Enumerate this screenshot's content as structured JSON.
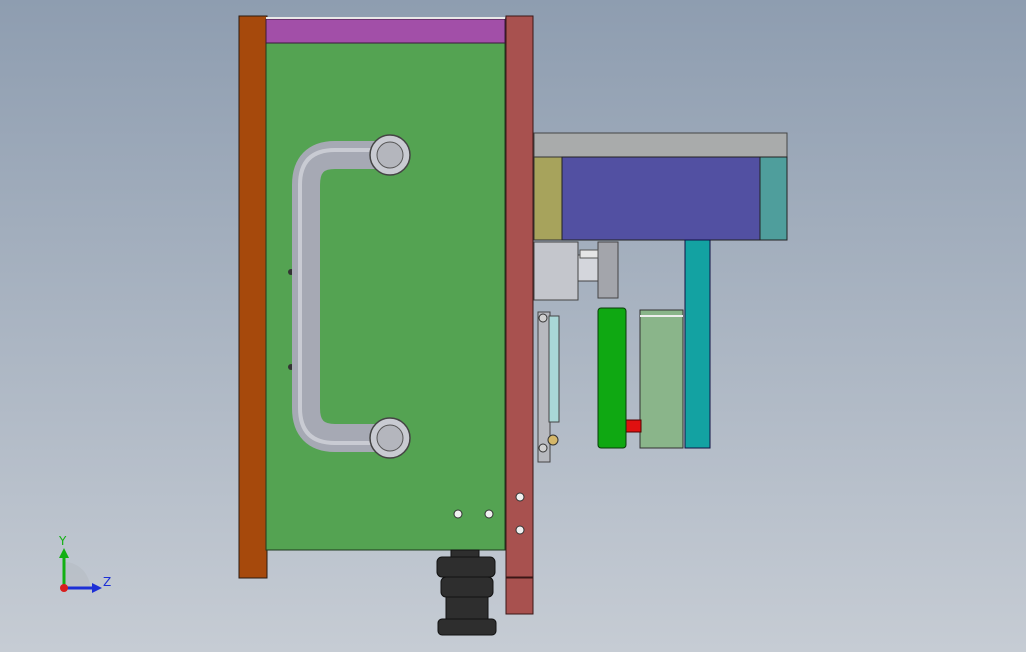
{
  "viewport": {
    "background_top": "#8e9db0",
    "background_bottom": "#c6ccd4"
  },
  "triad": {
    "y_label": "Y",
    "z_label": "Z",
    "y_color": "#13b013",
    "z_color": "#1c2fd6",
    "x_color": "#d81e1e"
  },
  "colors": {
    "orange_plate": "#a6490c",
    "magenta_strip": "#a24fa8",
    "green_plate": "#54a352",
    "rust_plate": "#a8514f",
    "handle": "#a6a9b4",
    "gray_bar": "#a9abab",
    "olive_block": "#a7a35c",
    "blue_block": "#5250a2",
    "teal_block": "#4f9e9c",
    "cyan_post": "#13a2a2",
    "bright_green_block": "#0fa812",
    "sage_block": "#8ab58a",
    "red_pin": "#e01010",
    "nut": "#2e2e2e"
  }
}
